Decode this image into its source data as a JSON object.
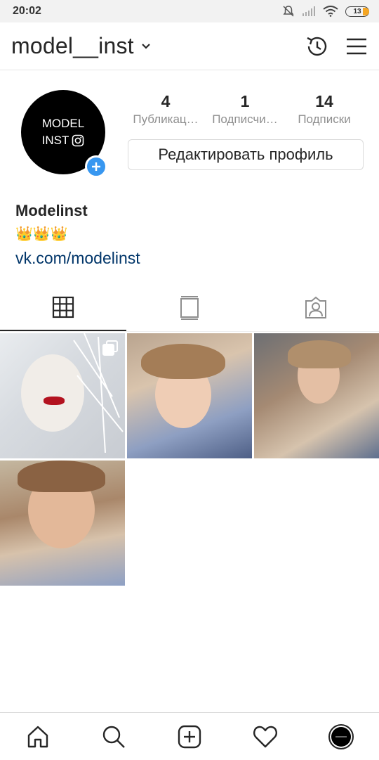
{
  "status_bar": {
    "time": "20:02",
    "battery": "13"
  },
  "header": {
    "username": "model__inst"
  },
  "profile": {
    "avatar_line1": "MODEL",
    "avatar_line2": "INST",
    "stats": [
      {
        "num": "4",
        "label": "Публикац…"
      },
      {
        "num": "1",
        "label": "Подписчи…"
      },
      {
        "num": "14",
        "label": "Подписки"
      }
    ],
    "edit_button": "Редактировать профиль",
    "name": "Modelinst",
    "bio": "👑👑👑",
    "link": "vk.com/modelinst"
  },
  "icons": {
    "header": [
      "chevron-down-icon",
      "archive-history-icon",
      "menu-icon"
    ],
    "tabs": [
      "grid-icon",
      "igtv-icon",
      "tagged-icon"
    ],
    "nav": [
      "home-icon",
      "search-icon",
      "new-post-icon",
      "activity-heart-icon",
      "profile-avatar-icon"
    ]
  },
  "colors": {
    "link": "#003569",
    "accent": "#3897f0",
    "text": "#262626",
    "muted": "#8e8e8e"
  }
}
